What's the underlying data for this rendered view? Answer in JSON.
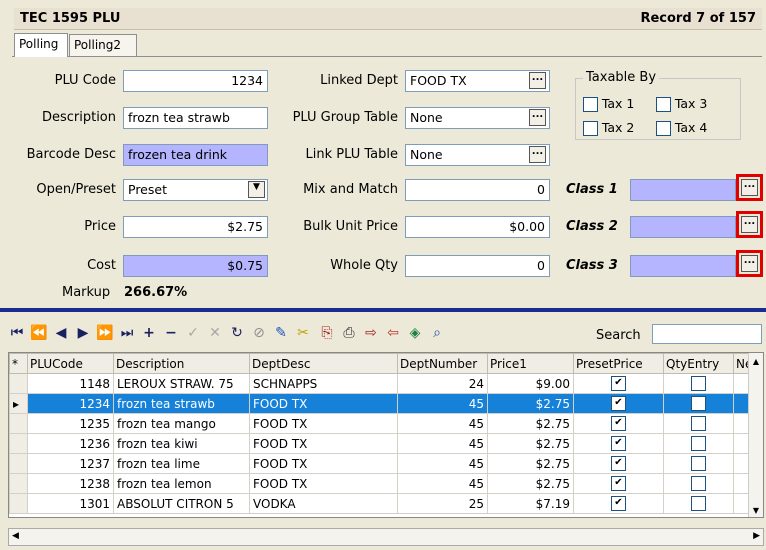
{
  "title": {
    "left": "TEC 1595 PLU",
    "right": "Record  7  of  157"
  },
  "tabs": [
    "Polling",
    "Polling2"
  ],
  "form": {
    "plu_code_label": "PLU Code",
    "plu_code": "1234",
    "description_label": "Description",
    "description": "frozn tea strawb",
    "barcode_label": "Barcode Desc",
    "barcode": "frozen tea drink",
    "open_preset_label": "Open/Preset",
    "open_preset": "Preset",
    "price_label": "Price",
    "price": "$2.75",
    "cost_label": "Cost",
    "cost": "$0.75",
    "markup_label": "Markup",
    "markup": "266.67%",
    "linked_dept_label": "Linked Dept",
    "linked_dept": "FOOD TX",
    "plu_group_label": "PLU Group Table",
    "plu_group": "None",
    "link_plu_label": "Link PLU Table",
    "link_plu": "None",
    "mix_match_label": "Mix and Match",
    "mix_match": "0",
    "bulk_price_label": "Bulk Unit Price",
    "bulk_price": "$0.00",
    "whole_qty_label": "Whole Qty",
    "whole_qty": "0",
    "class1_label": "Class 1",
    "class2_label": "Class 2",
    "class3_label": "Class 3",
    "taxable_label": "Taxable By",
    "tax1": "Tax 1",
    "tax2": "Tax 2",
    "tax3": "Tax 3",
    "tax4": "Tax 4",
    "ellipsis": "..."
  },
  "toolbar": {
    "search_label": "Search",
    "search_value": ""
  },
  "grid": {
    "headers": [
      "*",
      "PLUCode",
      "Description",
      "DeptDesc",
      "DeptNumber",
      "Price1",
      "PresetPrice",
      "QtyEntry",
      "Ne"
    ],
    "rows": [
      {
        "plu": "1148",
        "desc": "LEROUX STRAW. 75",
        "dept": "SCHNAPPS",
        "num": "24",
        "price": "$9.00",
        "preset": true,
        "qty": false,
        "sel": false
      },
      {
        "plu": "1234",
        "desc": "frozn tea strawb",
        "dept": "FOOD TX",
        "num": "45",
        "price": "$2.75",
        "preset": true,
        "qty": false,
        "sel": true
      },
      {
        "plu": "1235",
        "desc": "frozn tea mango",
        "dept": "FOOD TX",
        "num": "45",
        "price": "$2.75",
        "preset": true,
        "qty": false,
        "sel": false
      },
      {
        "plu": "1236",
        "desc": "frozn tea kiwi",
        "dept": "FOOD TX",
        "num": "45",
        "price": "$2.75",
        "preset": true,
        "qty": false,
        "sel": false
      },
      {
        "plu": "1237",
        "desc": "frozn tea lime",
        "dept": "FOOD TX",
        "num": "45",
        "price": "$2.75",
        "preset": true,
        "qty": false,
        "sel": false
      },
      {
        "plu": "1238",
        "desc": "frozn tea lemon",
        "dept": "FOOD TX",
        "num": "45",
        "price": "$2.75",
        "preset": true,
        "qty": false,
        "sel": false
      },
      {
        "plu": "1301",
        "desc": "ABSOLUT CITRON 5",
        "dept": "VODKA",
        "num": "25",
        "price": "$7.19",
        "preset": true,
        "qty": false,
        "sel": false
      }
    ]
  },
  "colors": {
    "selection": "#1681D9",
    "lavender": "#B4B4FF",
    "highlight_box": "#E00000",
    "separator": "#1A2C8F"
  }
}
